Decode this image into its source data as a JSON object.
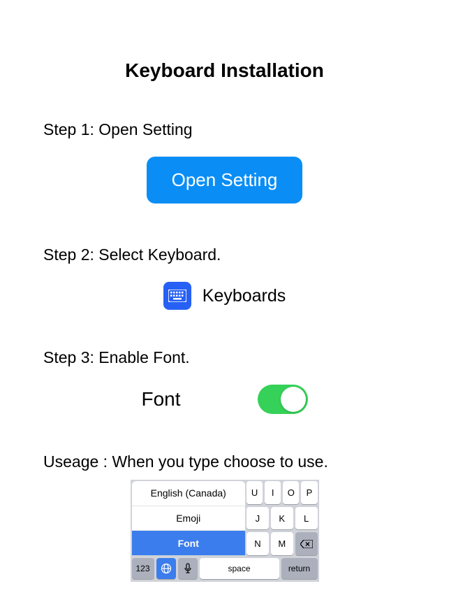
{
  "title": "Keyboard Installation",
  "step1": {
    "label": "Step 1: Open Setting",
    "button": "Open Setting"
  },
  "step2": {
    "label": "Step 2: Select Keyboard.",
    "item": "Keyboards"
  },
  "step3": {
    "label": "Step 3: Enable Font.",
    "item": "Font",
    "toggle": true
  },
  "usage": {
    "label": "Useage : When you type choose to use."
  },
  "keyboard": {
    "langMenu": [
      "English (Canada)",
      "Emoji",
      "Font"
    ],
    "selectedLang": "Font",
    "topRow": [
      "U",
      "I",
      "O",
      "P"
    ],
    "midRow": [
      "J",
      "K",
      "L"
    ],
    "botRow": [
      "N",
      "M"
    ],
    "numKey": "123",
    "spaceKey": "space",
    "returnKey": "return"
  }
}
